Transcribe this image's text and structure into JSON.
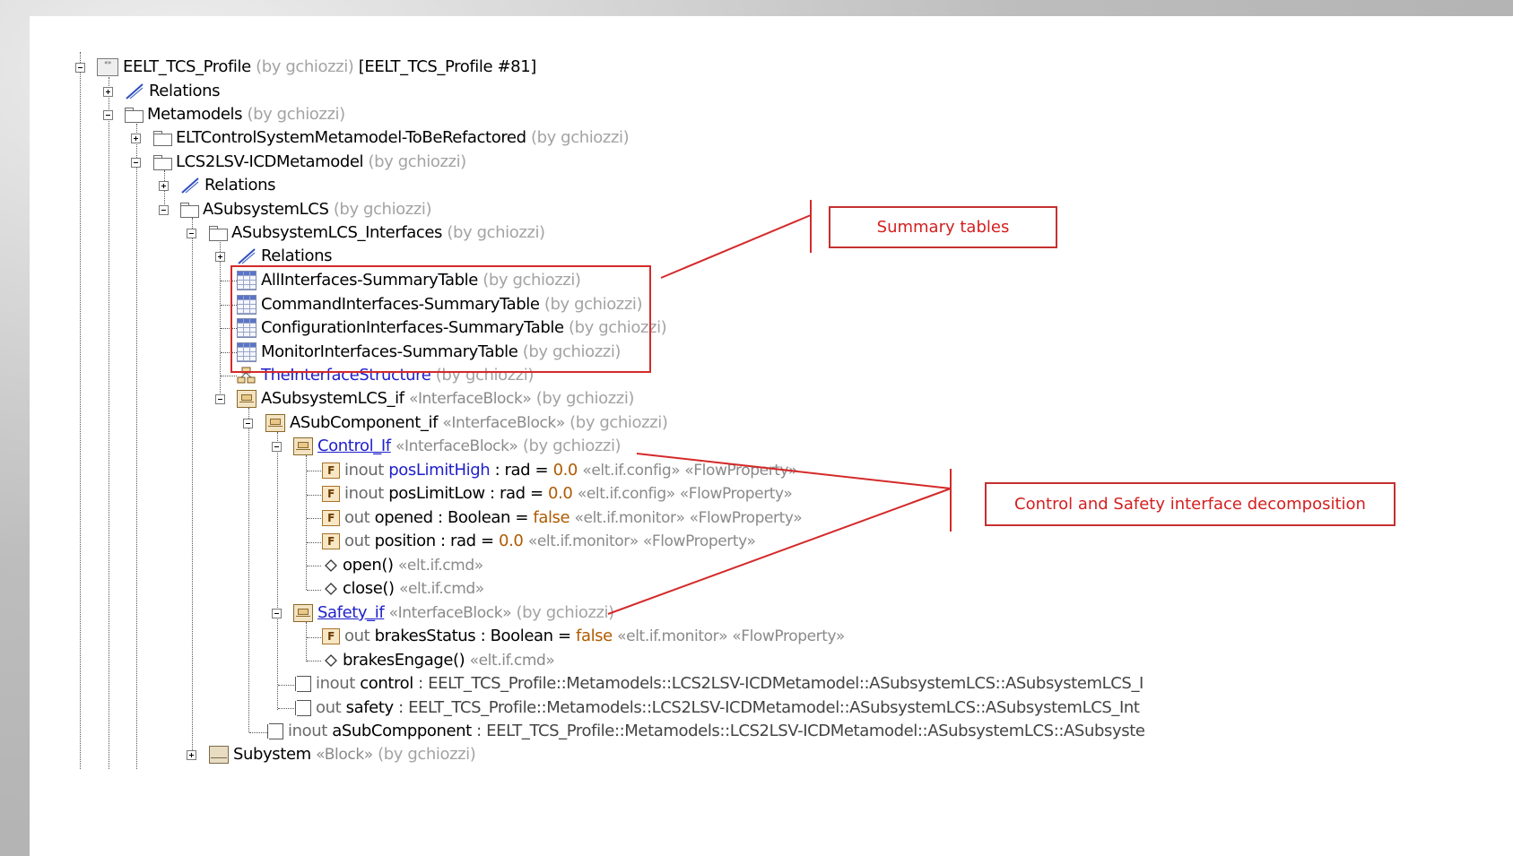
{
  "tree": [
    {
      "name": "EELT_TCS_Profile",
      "author": "(by gchiozzi)",
      "suffix": "[EELT_TCS_Profile #81]",
      "icon": "profile-package-icon",
      "expander": "minus"
    },
    {
      "name": "Relations",
      "icon": "relations-icon",
      "expander": "plus"
    },
    {
      "name": "Metamodels",
      "author": "(by gchiozzi)",
      "icon": "folder-icon",
      "expander": "minus"
    },
    {
      "name": "ELTControlSystemMetamodel-ToBeRefactored",
      "author": "(by gchiozzi)",
      "icon": "folder-icon",
      "expander": "plus"
    },
    {
      "name": "LCS2LSV-ICDMetamodel",
      "author": "(by gchiozzi)",
      "icon": "folder-icon",
      "expander": "minus"
    },
    {
      "name": "Relations",
      "icon": "relations-icon",
      "expander": "plus"
    },
    {
      "name": "ASubsystemLCS",
      "author": "(by gchiozzi)",
      "icon": "folder-icon",
      "expander": "minus"
    },
    {
      "name": "ASubsystemLCS_Interfaces",
      "author": "(by gchiozzi)",
      "icon": "folder-icon",
      "expander": "minus"
    },
    {
      "name": "Relations",
      "icon": "relations-icon",
      "expander": "plus"
    },
    {
      "name": "AllInterfaces-SummaryTable",
      "author": "(by gchiozzi)",
      "icon": "table-icon"
    },
    {
      "name": "CommandInterfaces-SummaryTable",
      "author": "(by gchiozzi)",
      "icon": "table-icon"
    },
    {
      "name": "ConfigurationInterfaces-SummaryTable",
      "author": "(by gchiozzi)",
      "icon": "table-icon"
    },
    {
      "name": "MonitorInterfaces-SummaryTable",
      "author": "(by gchiozzi)",
      "icon": "table-icon"
    },
    {
      "name": "TheInterfaceStructure",
      "author": "(by gchiozzi)",
      "icon": "structure-diagram-icon"
    },
    {
      "name": "ASubsystemLCS_if",
      "stereotype": "«InterfaceBlock»",
      "author": "(by gchiozzi)",
      "icon": "interface-block-icon",
      "expander": "minus"
    },
    {
      "name": "ASubComponent_if",
      "stereotype": "«InterfaceBlock»",
      "author": "(by gchiozzi)",
      "icon": "interface-block-icon",
      "expander": "minus"
    },
    {
      "name": "Control_If",
      "stereotype": "«InterfaceBlock»",
      "author": "(by gchiozzi)",
      "icon": "interface-block-icon",
      "expander": "minus"
    },
    {
      "dir": "inout",
      "name": "posLimitHigh",
      "type": ": rad",
      "eq": "=",
      "val": "0.0",
      "stereotype": "«elt.if.config» «FlowProperty»",
      "icon": "flow-property-icon"
    },
    {
      "dir": "inout",
      "name": "posLimitLow",
      "type": ": rad",
      "eq": "=",
      "val": "0.0",
      "stereotype": "«elt.if.config» «FlowProperty»",
      "icon": "flow-property-icon"
    },
    {
      "dir": "out",
      "name": "opened",
      "type": ": Boolean",
      "eq": "=",
      "val": "false",
      "stereotype": "«elt.if.monitor» «FlowProperty»",
      "icon": "flow-property-icon"
    },
    {
      "dir": "out",
      "name": "position",
      "type": ": rad",
      "eq": "=",
      "val": "0.0",
      "stereotype": "«elt.if.monitor» «FlowProperty»",
      "icon": "flow-property-icon"
    },
    {
      "name": "open()",
      "stereotype": "«elt.if.cmd»",
      "icon": "operation-icon"
    },
    {
      "name": "close()",
      "stereotype": "«elt.if.cmd»",
      "icon": "operation-icon"
    },
    {
      "name": "Safety_if",
      "stereotype": "«InterfaceBlock»",
      "author": "(by gchiozzi)",
      "icon": "interface-block-icon",
      "expander": "minus"
    },
    {
      "dir": "out",
      "name": "brakesStatus",
      "type": ": Boolean",
      "eq": "=",
      "val": "false",
      "stereotype": "«elt.if.monitor» «FlowProperty»",
      "icon": "flow-property-icon"
    },
    {
      "name": "brakesEngage()",
      "stereotype": "«elt.if.cmd»",
      "icon": "operation-icon"
    },
    {
      "dir": "inout",
      "name": "control",
      "type": ": EELT_TCS_Profile::Metamodels::LCS2LSV-ICDMetamodel::ASubsystemLCS::ASubsystemLCS_I",
      "icon": "port-icon"
    },
    {
      "dir": "out",
      "name": "safety",
      "type": ": EELT_TCS_Profile::Metamodels::LCS2LSV-ICDMetamodel::ASubsystemLCS::ASubsystemLCS_Int",
      "icon": "port-icon"
    },
    {
      "dir": "inout",
      "name": "aSubCompponent",
      "type": ": EELT_TCS_Profile::Metamodels::LCS2LSV-ICDMetamodel::ASubsystemLCS::ASubsyste",
      "icon": "port-icon"
    },
    {
      "name": "Subystem",
      "stereotype": "«Block»",
      "author": "(by gchiozzi)",
      "icon": "block-icon",
      "expander": "plus"
    }
  ],
  "callouts": {
    "summary_tables": "Summary tables",
    "control_safety": "Control and Safety interface decomposition"
  },
  "colors": {
    "annotation_red": "#d42a2a",
    "link_blue": "#1f1fcc",
    "value_orange": "#b05a00",
    "author_gray": "#a3a3a3"
  }
}
